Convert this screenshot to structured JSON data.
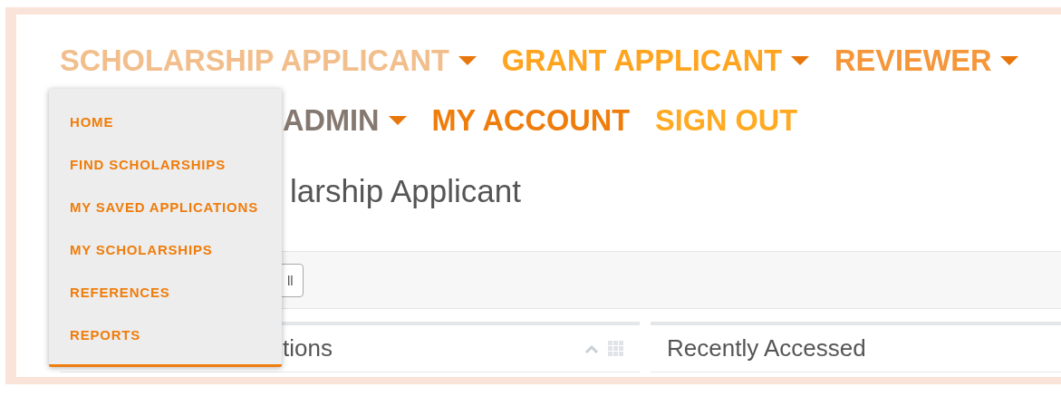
{
  "nav": [
    {
      "label": "SCHOLARSHIP APPLICANT",
      "kind": "menu",
      "color": "#f2be8c",
      "menu_items": [
        "HOME",
        "FIND SCHOLARSHIPS",
        "MY SAVED APPLICATIONS",
        "MY SCHOLARSHIPS",
        "REFERENCES",
        "REPORTS"
      ]
    },
    {
      "label": "GRANT APPLICANT",
      "kind": "menu",
      "color": "#ffa41f"
    },
    {
      "label": "REVIEWER",
      "kind": "menu",
      "color": "#f5963a"
    },
    {
      "label": "ADMIN",
      "kind": "menu",
      "color": "#857870"
    },
    {
      "label": "MY ACCOUNT",
      "kind": "link",
      "color": "#ef7d0c"
    },
    {
      "label": "SIGN OUT",
      "kind": "link",
      "color": "#ffaa22"
    }
  ],
  "page_title": "larship Applicant",
  "toolbar": {
    "button": "ll"
  },
  "panels": [
    {
      "title": "tions",
      "kind": "tools"
    },
    {
      "title": "Recently Accessed",
      "kind": "plain"
    }
  ]
}
